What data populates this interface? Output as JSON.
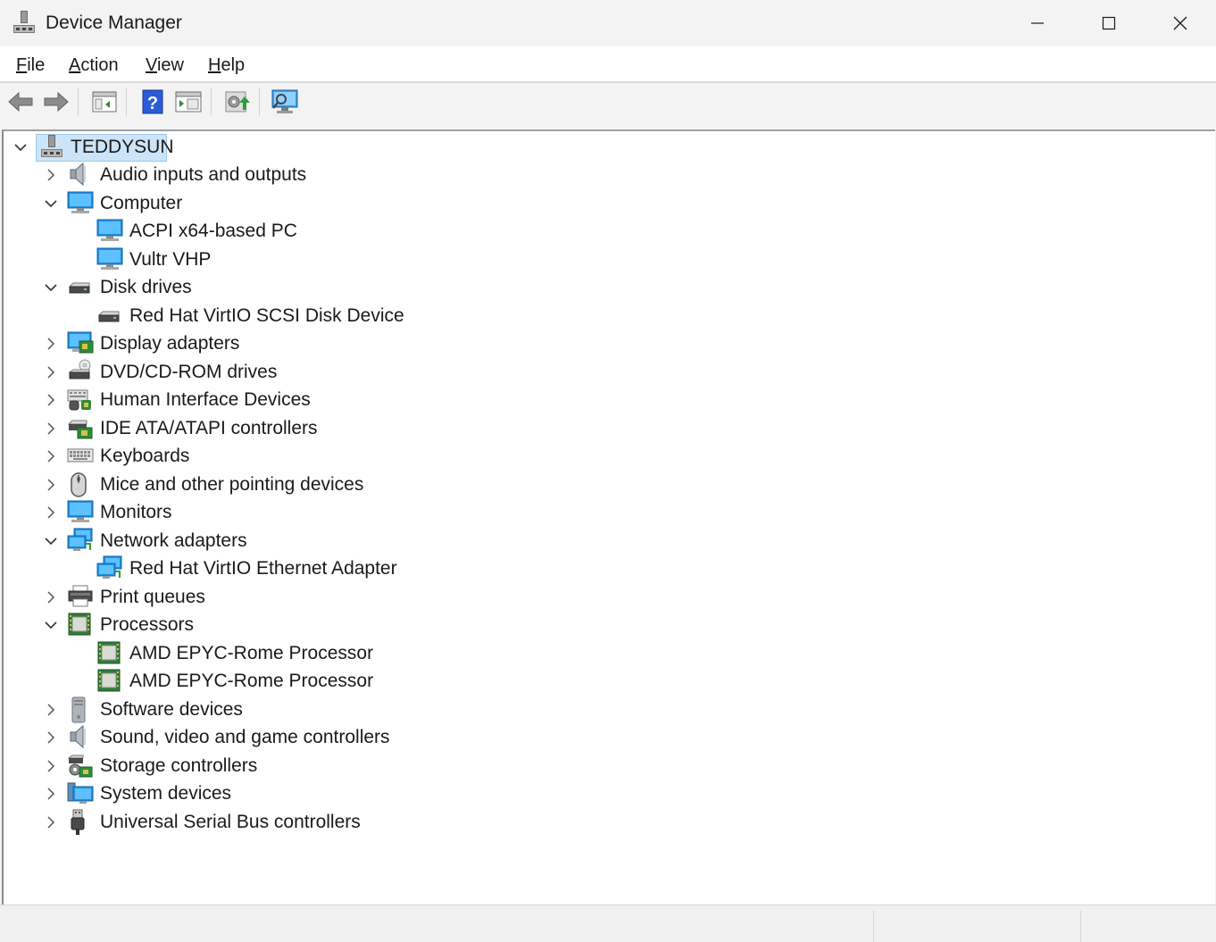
{
  "window": {
    "title": "Device Manager",
    "controls": [
      "minimize",
      "maximize",
      "close"
    ]
  },
  "menu": {
    "items": [
      {
        "label_ul": "F",
        "label_rest": "ile"
      },
      {
        "label_ul": "A",
        "label_rest": "ction"
      },
      {
        "label_ul": "V",
        "label_rest": "iew"
      },
      {
        "label_ul": "H",
        "label_rest": "elp"
      }
    ]
  },
  "toolbar": {
    "buttons": [
      "back-icon",
      "forward-icon",
      "show-hide-console-tree-icon",
      "help-icon",
      "properties-icon",
      "update-driver-icon",
      "scan-hardware-icon"
    ]
  },
  "tree": {
    "root": {
      "label": "TEDDYSUN",
      "expanded": true
    },
    "nodes": [
      {
        "label": "Audio inputs and outputs",
        "level": 1,
        "state": "collapsed",
        "icon": "speaker-icon"
      },
      {
        "label": "Computer",
        "level": 1,
        "state": "expanded",
        "icon": "monitor-icon"
      },
      {
        "label": "ACPI x64-based PC",
        "level": 2,
        "state": "leaf",
        "icon": "monitor-icon"
      },
      {
        "label": "Vultr VHP",
        "level": 2,
        "state": "leaf",
        "icon": "monitor-icon"
      },
      {
        "label": "Disk drives",
        "level": 1,
        "state": "expanded",
        "icon": "disk-drive-icon"
      },
      {
        "label": "Red Hat VirtIO SCSI Disk Device",
        "level": 2,
        "state": "leaf",
        "icon": "disk-drive-icon"
      },
      {
        "label": "Display adapters",
        "level": 1,
        "state": "collapsed",
        "icon": "display-adapter-icon"
      },
      {
        "label": "DVD/CD-ROM drives",
        "level": 1,
        "state": "collapsed",
        "icon": "dvd-drive-icon"
      },
      {
        "label": "Human Interface Devices",
        "level": 1,
        "state": "collapsed",
        "icon": "hid-icon"
      },
      {
        "label": "IDE ATA/ATAPI controllers",
        "level": 1,
        "state": "collapsed",
        "icon": "ide-controller-icon"
      },
      {
        "label": "Keyboards",
        "level": 1,
        "state": "collapsed",
        "icon": "keyboard-icon"
      },
      {
        "label": "Mice and other pointing devices",
        "level": 1,
        "state": "collapsed",
        "icon": "mouse-icon"
      },
      {
        "label": "Monitors",
        "level": 1,
        "state": "collapsed",
        "icon": "monitor-icon"
      },
      {
        "label": "Network adapters",
        "level": 1,
        "state": "expanded",
        "icon": "network-adapter-icon"
      },
      {
        "label": "Red Hat VirtIO Ethernet Adapter",
        "level": 2,
        "state": "leaf",
        "icon": "network-adapter-icon"
      },
      {
        "label": "Print queues",
        "level": 1,
        "state": "collapsed",
        "icon": "printer-icon"
      },
      {
        "label": "Processors",
        "level": 1,
        "state": "expanded",
        "icon": "processor-icon"
      },
      {
        "label": "AMD EPYC-Rome Processor",
        "level": 2,
        "state": "leaf",
        "icon": "processor-icon"
      },
      {
        "label": "AMD EPYC-Rome Processor",
        "level": 2,
        "state": "leaf",
        "icon": "processor-icon"
      },
      {
        "label": "Software devices",
        "level": 1,
        "state": "collapsed",
        "icon": "software-device-icon"
      },
      {
        "label": "Sound, video and game controllers",
        "level": 1,
        "state": "collapsed",
        "icon": "speaker-icon"
      },
      {
        "label": "Storage controllers",
        "level": 1,
        "state": "collapsed",
        "icon": "storage-controller-icon"
      },
      {
        "label": "System devices",
        "level": 1,
        "state": "collapsed",
        "icon": "system-devices-icon"
      },
      {
        "label": "Universal Serial Bus controllers",
        "level": 1,
        "state": "collapsed",
        "icon": "usb-icon"
      }
    ]
  },
  "colors": {
    "selection_bg": "#cce4f7",
    "selection_border": "#99c9ef",
    "text": "#1a1a1a",
    "chrome": "#f3f3f3"
  }
}
